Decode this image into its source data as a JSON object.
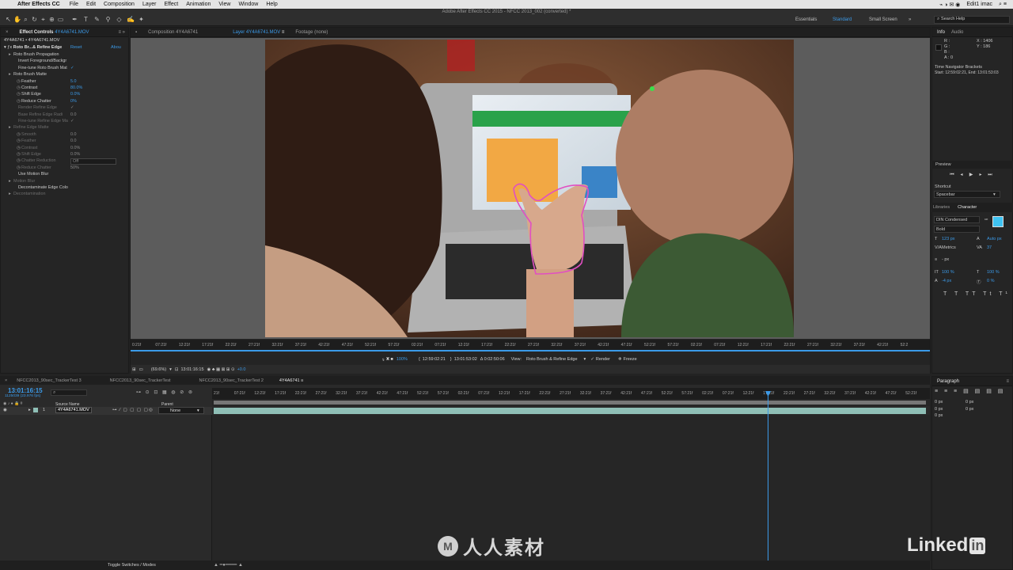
{
  "menubar": {
    "app_name": "After Effects CC",
    "items": [
      "File",
      "Edit",
      "Composition",
      "Layer",
      "Effect",
      "Animation",
      "View",
      "Window",
      "Help"
    ],
    "right": [
      "Edit1 imac"
    ]
  },
  "window_title": "Adobe After Effects CC 2015 - NFCC 2013_002 (converted) *",
  "workspaces": [
    "Essentials",
    "Standard",
    "Small Screen"
  ],
  "workspace_active": "Standard",
  "search_help": "Search Help",
  "effect_controls": {
    "tab_label": "Effect Controls",
    "tab_file": "4Y4A6741.MOV",
    "subheader": "4Y4A6741 • 4Y4A6741.MOV",
    "effect_name": "Roto Br...& Refine Edge",
    "reset": "Reset",
    "about": "Abou",
    "rows": [
      {
        "label": "Roto Brush Propagation",
        "value": "",
        "dim": false
      },
      {
        "label": "Invert Foreground/Backgr",
        "value": "",
        "dim": false
      },
      {
        "label": "Fine-tune Roto Brush Mat",
        "value": "✓",
        "dim": false
      },
      {
        "label": "Roto Brush Matte",
        "value": "",
        "dim": false
      },
      {
        "label": "Feather",
        "value": "5.0",
        "dim": false
      },
      {
        "label": "Contrast",
        "value": "80.0%",
        "dim": false
      },
      {
        "label": "Shift Edge",
        "value": "0.0%",
        "dim": false
      },
      {
        "label": "Reduce Chatter",
        "value": "0%",
        "dim": false
      },
      {
        "label": "Render Refine Edge",
        "value": "✓",
        "dim": true
      },
      {
        "label": "Base Refine Edge Radi",
        "value": "0.0",
        "dim": true
      },
      {
        "label": "Fine-tune Refine Edge Ma",
        "value": "✓",
        "dim": true
      },
      {
        "label": "Refine Edge Matte",
        "value": "",
        "dim": true
      },
      {
        "label": "Smooth",
        "value": "0.0",
        "dim": true
      },
      {
        "label": "Feather",
        "value": "0.0",
        "dim": true
      },
      {
        "label": "Contrast",
        "value": "0.0%",
        "dim": true
      },
      {
        "label": "Shift Edge",
        "value": "0.0%",
        "dim": true
      },
      {
        "label": "Chatter Reduction",
        "value": "Off",
        "dim": true
      },
      {
        "label": "Reduce Chatter",
        "value": "50%",
        "dim": true
      },
      {
        "label": "Use Motion Blur",
        "value": "",
        "dim": false
      },
      {
        "label": "Motion Blur",
        "value": "",
        "dim": true
      },
      {
        "label": "Decontaminate Edge Colo",
        "value": "",
        "dim": false
      },
      {
        "label": "Decontamination",
        "value": "",
        "dim": true
      }
    ]
  },
  "viewer_tabs": [
    {
      "label": "Composition 4Y4A6741",
      "active": false
    },
    {
      "label": "Layer 4Y4A6741.MOV",
      "active": true
    },
    {
      "label": "Footage (none)",
      "active": false
    }
  ],
  "viewer_ruler_ticks": [
    "0:21f",
    "07:21f",
    "12:21f",
    "17:21f",
    "22:21f",
    "27:21f",
    "32:21f",
    "37:21f",
    "42:21f",
    "47:21f",
    "52:21f",
    "57:21f",
    "02:21f",
    "07:21f",
    "12:21f",
    "17:21f",
    "22:21f",
    "27:21f",
    "32:21f",
    "37:21f",
    "42:21f",
    "47:21f",
    "52:21f",
    "57:21f",
    "02:21f",
    "07:21f",
    "12:21f",
    "17:21f",
    "22:21f",
    "27:21f",
    "32:21f",
    "37:21f",
    "42:21f",
    "52:2"
  ],
  "viewer_bottom_bar": {
    "zoom": "(69.6%)",
    "timecode": "13:01:16:15",
    "offset": "+0.0"
  },
  "layer_bar": {
    "magnification": "100%",
    "in_point": "12:59:02:21",
    "out_point": "13:01:53:02",
    "duration": "Δ 0:02:50:06",
    "view_label": "View:",
    "view_value": "Roto Brush & Refine Edge",
    "render": "Render",
    "freeze": "Freeze"
  },
  "timeline": {
    "tabs": [
      {
        "label": "NFCC2013_90sec_TrackerTest 3",
        "active": false
      },
      {
        "label": "NFCC2013_90sec_TrackerTest",
        "active": false
      },
      {
        "label": "NFCC2013_90sec_TrackerTest 2",
        "active": false
      },
      {
        "label": "4Y4A6741",
        "active": true
      }
    ],
    "current_time": "13:01:16:15",
    "frame_info": "1125039 (23.976 fps)",
    "source_name_header": "Source Name",
    "parent_header": "Parent",
    "layer_number": "1",
    "layer_name": "4Y4A6741.MOV",
    "parent_value": "None",
    "toggle_label": "Toggle Switches / Modes",
    "ruler_ticks": [
      "21f",
      "07:21f",
      "12:21f",
      "17:21f",
      "22:21f",
      "27:21f",
      "32:21f",
      "37:21f",
      "42:21f",
      "47:21f",
      "52:21f",
      "57:21f",
      "02:21f",
      "07:21f",
      "12:21f",
      "17:21f",
      "22:21f",
      "27:21f",
      "32:21f",
      "37:21f",
      "42:21f",
      "47:21f",
      "52:21f",
      "57:21f",
      "02:21f",
      "07:21f",
      "12:21f",
      "17:21f",
      "22:21f",
      "27:21f",
      "32:21f",
      "37:21f",
      "42:21f",
      "47:21f",
      "52:21f"
    ]
  },
  "info_panel": {
    "tabs": [
      "Info",
      "Audio"
    ],
    "r": "R :",
    "g": "G :",
    "b": "B :",
    "a": "A : 0",
    "x": "X : 1406",
    "y": "Y : 186",
    "nav_title": "Time Navigator Brackets",
    "nav_range": "Start: 12:59:02:21, End: 13:01:53:03"
  },
  "preview_panel": {
    "title": "Preview",
    "shortcut_label": "Shortcut",
    "shortcut_value": "Spacebar"
  },
  "character_panel": {
    "tabs": [
      "Libraries",
      "Character"
    ],
    "font": "DIN Condensed",
    "style": "Bold",
    "size": "123 px",
    "leading": "Auto px",
    "kerning": "Metrics",
    "tracking": "37",
    "stroke": "- px",
    "vscale": "100 %",
    "hscale": "100 %",
    "baseline": "-4 px",
    "tsume": "0 %",
    "fill_color": "#3fc3f2"
  },
  "paragraph_panel": {
    "title": "Paragraph",
    "indent_left": "0 px",
    "indent_first": "0 px",
    "indent_right": "0 px",
    "space_before": "0 px",
    "space_after": "0 px"
  },
  "watermark": {
    "brand": "Linked",
    "brand_in": "in",
    "cn_text": "人人素材"
  },
  "colors": {
    "accent": "#3b9ae8",
    "roto_outline": "#e14fc2",
    "track_point": "#3ae04a"
  }
}
